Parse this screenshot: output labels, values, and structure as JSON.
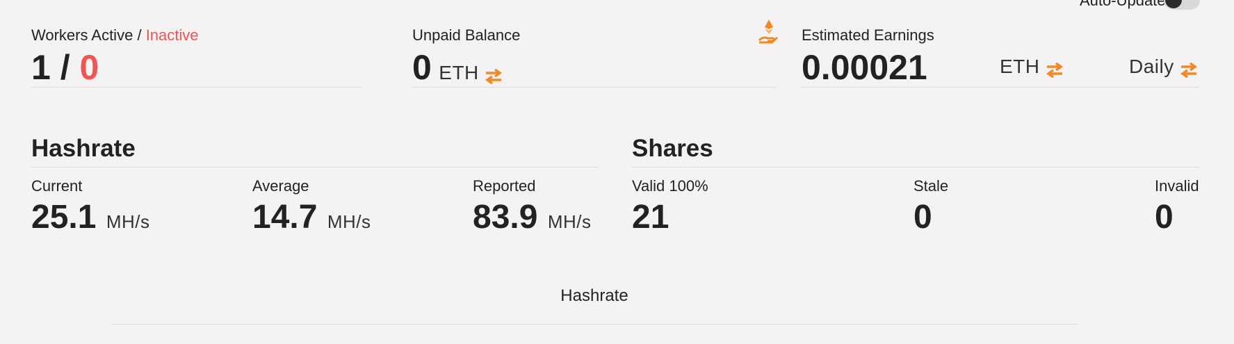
{
  "top": {
    "auto_update_label": "Auto-Update",
    "auto_update_on": false
  },
  "workers": {
    "label_active": "Workers Active",
    "label_sep": "/",
    "label_inactive": "Inactive",
    "active_count": "1",
    "value_sep": "/",
    "inactive_count": "0"
  },
  "balance": {
    "label": "Unpaid Balance",
    "value": "0",
    "unit": "ETH",
    "icon": "hand-ethereum-icon"
  },
  "earnings": {
    "label": "Estimated Earnings",
    "value": "0.00021",
    "unit": "ETH",
    "period": "Daily"
  },
  "hashrate": {
    "title": "Hashrate",
    "items": [
      {
        "label": "Current",
        "value": "25.1",
        "unit": "MH/s"
      },
      {
        "label": "Average",
        "value": "14.7",
        "unit": "MH/s"
      },
      {
        "label": "Reported",
        "value": "83.9",
        "unit": "MH/s"
      }
    ]
  },
  "shares": {
    "title": "Shares",
    "items": [
      {
        "label": "Valid 100%",
        "value": "21"
      },
      {
        "label": "Stale",
        "value": "0"
      },
      {
        "label": "Invalid",
        "value": "0"
      }
    ]
  },
  "chart": {
    "title": "Hashrate"
  },
  "colors": {
    "accent": "#f08a24",
    "inactive": "#f05454",
    "text": "#222222",
    "background": "#f4f2f2"
  }
}
